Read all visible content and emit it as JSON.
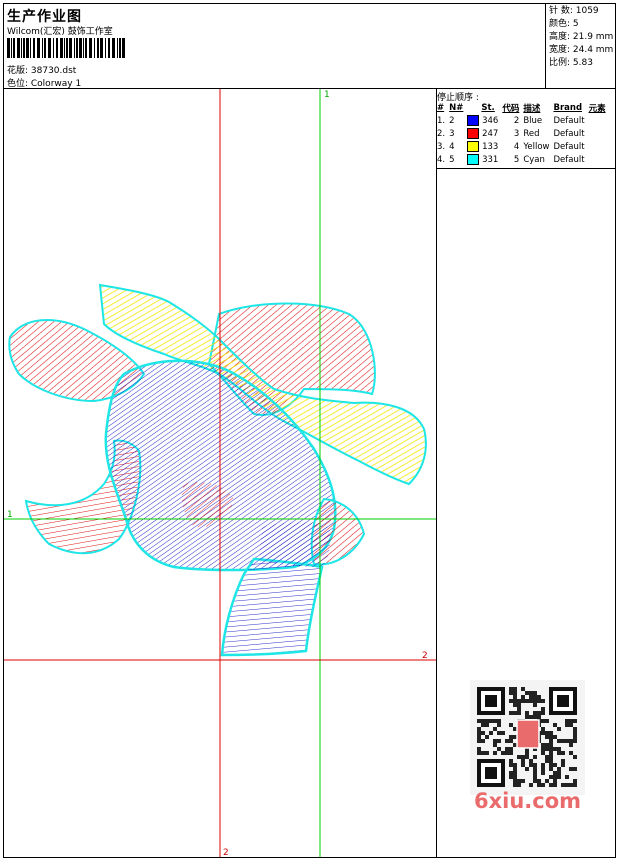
{
  "header": {
    "title": "生产作业图",
    "studio": "Wilcom(汇宏) 鼓饰工作室",
    "design": "花版: 38730.dst",
    "colorway": "色位: Colorway 1"
  },
  "stats": {
    "stitches": "针 数: 1059",
    "colors": "颜色: 5",
    "height": "高度: 21.9 mm",
    "width": "宽度: 24.4 mm",
    "scale": "比例: 5.83"
  },
  "stop_sequence": {
    "title": "停止顺序 :",
    "headers": [
      "#",
      "N#",
      "St.",
      "代码",
      "描述",
      "Brand",
      "元素"
    ],
    "rows": [
      {
        "num": "1.",
        "needle": "2",
        "color": "#0000ff",
        "stitches": "346",
        "code": "2",
        "desc": "Blue",
        "brand": "Default"
      },
      {
        "num": "2.",
        "needle": "3",
        "color": "#ff0000",
        "stitches": "247",
        "code": "3",
        "desc": "Red",
        "brand": "Default"
      },
      {
        "num": "3.",
        "needle": "4",
        "color": "#ffff00",
        "stitches": "133",
        "code": "4",
        "desc": "Yellow",
        "brand": "Default"
      },
      {
        "num": "4.",
        "needle": "5",
        "color": "#00ffff",
        "stitches": "331",
        "code": "5",
        "desc": "Cyan",
        "brand": "Default"
      }
    ]
  },
  "guides": {
    "green_label": "1",
    "red_label": "2"
  },
  "watermark": "6xiu.com",
  "colors": {
    "blue": "#1414c8",
    "red": "#e01010",
    "yellow": "#f5f000",
    "cyan": "#1ee6e6",
    "guide_green": "#00cc00",
    "guide_red": "#dd0000"
  }
}
